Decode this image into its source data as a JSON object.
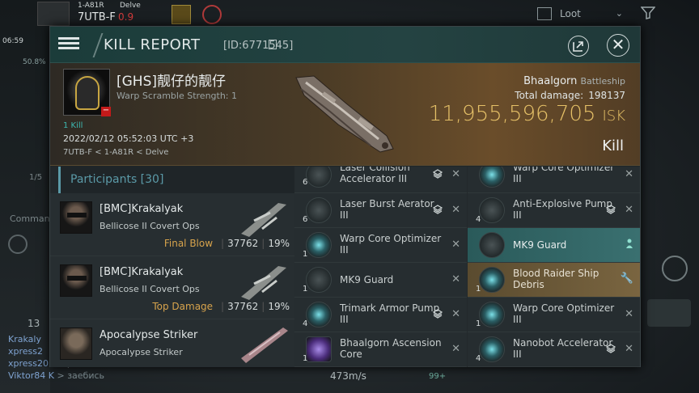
{
  "hud": {
    "pilot_system": "1-A81R",
    "region": "Delve",
    "system_code": "7UTB-F",
    "security": "0.9",
    "time": "06:59",
    "percent": "50.8%",
    "loot_label": "Loot",
    "side_fraction": "1/5",
    "command_label": "Comman",
    "chat_count": "13",
    "speed": "473m/s",
    "bottom_badge": "99+"
  },
  "chat": [
    {
      "name": "Krakaly",
      "text": ""
    },
    {
      "name": "xpress2",
      "text": ""
    },
    {
      "name": "xpress20",
      "text": "> красавчик"
    },
    {
      "name": "Viktor84 K",
      "text": "> заебись"
    }
  ],
  "window": {
    "title": "KILL REPORT",
    "id_label": "[ID:6771545]"
  },
  "victim": {
    "name": "[GHS]靓仔的靓仔",
    "subtitle": "Warp Scramble Strength: 1",
    "kills": "1 Kill",
    "datetime": "2022/02/12 05:52:03 UTC +3",
    "location": "7UTB-F < 1-A81R < Delve",
    "ship": "Bhaalgorn",
    "ship_class": "Battleship",
    "total_damage_label": "Total damage:",
    "total_damage": "198137",
    "isk_value": "11,955,596,705",
    "isk_unit": "ISK",
    "result": "Kill"
  },
  "participants": {
    "header": "Participants [30]",
    "rows": [
      {
        "name": "[BMC]Krakalyak",
        "ship": "Bellicose II Covert Ops",
        "tag": "Final Blow",
        "damage": "37762",
        "percent": "19%"
      },
      {
        "name": "[BMC]Krakalyak",
        "ship": "Bellicose II Covert Ops",
        "tag": "Top Damage",
        "damage": "37762",
        "percent": "19%"
      },
      {
        "name": "Apocalypse Striker",
        "ship": "Apocalypse Striker",
        "tag": "",
        "damage": "",
        "percent": ""
      }
    ]
  },
  "modules_left": [
    {
      "qty": "6",
      "line1": "Laser Collision",
      "line2": "Accelerator III",
      "icon": "laser-icon",
      "layers": true
    },
    {
      "qty": "6",
      "line1": "Laser Burst Aerator",
      "line2": "III",
      "icon": "laser-icon",
      "layers": true
    },
    {
      "qty": "1",
      "line1": "Warp Core Optimizer",
      "line2": "III",
      "icon": "warp-core-icon",
      "layers": false
    },
    {
      "qty": "1",
      "line1": "MK9  Guard",
      "line2": "",
      "icon": "guard-icon",
      "layers": false
    },
    {
      "qty": "4",
      "line1": "Trimark Armor Pump",
      "line2": "III",
      "icon": "armor-pump-icon",
      "layers": true
    },
    {
      "qty": "1",
      "line1": "Bhaalgorn Ascension",
      "line2": "Core",
      "icon": "ascension-core-icon",
      "layers": false
    }
  ],
  "modules_right": [
    {
      "qty": "",
      "line1": "Warp Core Optimizer",
      "line2": "III",
      "icon": "warp-core-icon",
      "layers": false
    },
    {
      "qty": "4",
      "line1": "Anti-Explosive Pump",
      "line2": "III",
      "icon": "pump-icon",
      "layers": true
    },
    {
      "qty": "",
      "line1": "MK9  Guard",
      "line2": "",
      "icon": "guard-icon",
      "layers": false
    },
    {
      "qty": "1",
      "line1": "Blood Raider Ship",
      "line2": "Debris",
      "icon": "debris-icon",
      "layers": false
    },
    {
      "qty": "1",
      "line1": "Warp Core Optimizer",
      "line2": "III",
      "icon": "warp-core-icon",
      "layers": false
    },
    {
      "qty": "4",
      "line1": "Nanobot Accelerator",
      "line2": "III",
      "icon": "nanobot-icon",
      "layers": true
    }
  ],
  "colors": {
    "isk_gold": "#e5c067",
    "header_teal": "#244342",
    "final_blow": "#d7a34c",
    "participants_accent": "#5b9aa8",
    "dropped_green": "#3a7070",
    "destroyed_gold": "#7a6540"
  }
}
